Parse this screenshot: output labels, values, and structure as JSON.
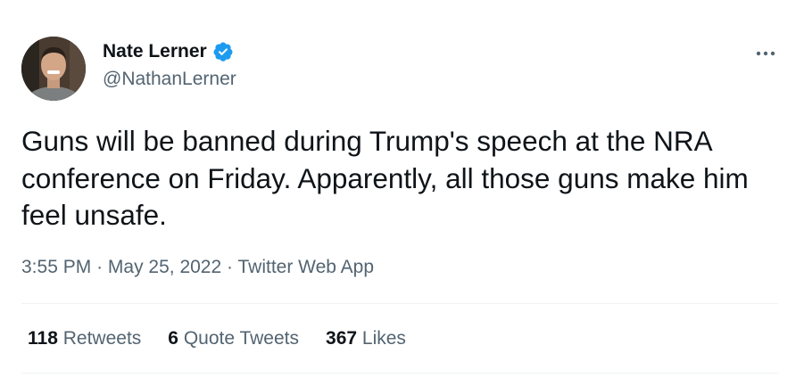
{
  "author": {
    "display_name": "Nate Lerner",
    "handle": "@NathanLerner",
    "verified": true
  },
  "tweet": {
    "text": "Guns will be banned during Trump's speech at the NRA conference on Friday. Apparently, all those guns make him feel unsafe.",
    "time": "3:55 PM",
    "date": "May 25, 2022",
    "source": "Twitter Web App",
    "separator": "·"
  },
  "stats": {
    "retweets": {
      "count": "118",
      "label": "Retweets"
    },
    "quote_tweets": {
      "count": "6",
      "label": "Quote Tweets"
    },
    "likes": {
      "count": "367",
      "label": "Likes"
    }
  },
  "colors": {
    "primary_text": "#0f1419",
    "secondary_text": "#536471",
    "verified_blue": "#1d9bf0",
    "divider": "#eff3f4"
  },
  "icons": {
    "verified": "verified-badge-icon",
    "more": "more-options-icon"
  }
}
